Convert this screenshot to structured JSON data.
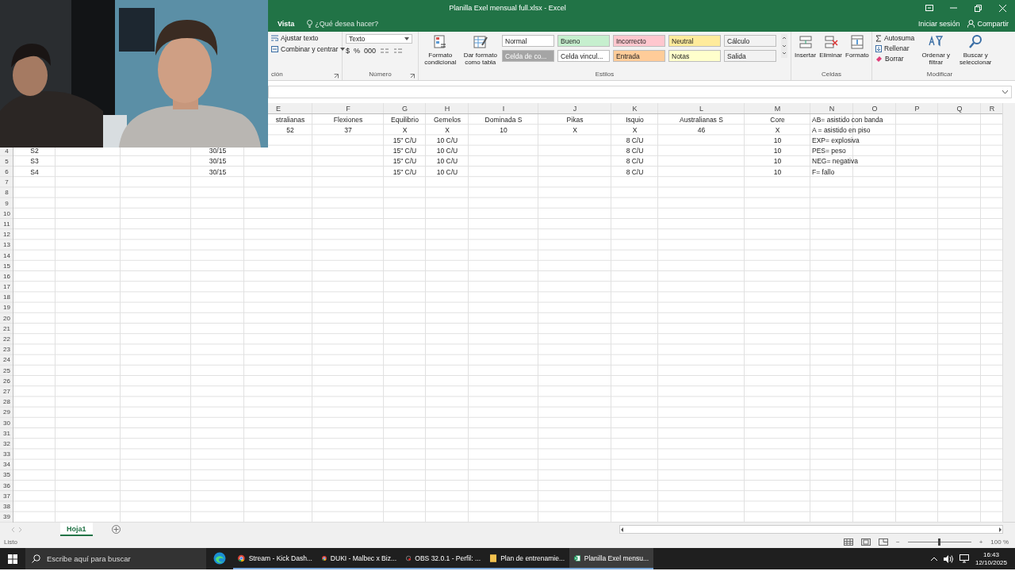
{
  "window": {
    "title": "Planilla Exel mensual full.xlsx - Excel"
  },
  "ribbon_tabs": {
    "tabs": [
      {
        "label": "Vista",
        "selected": false
      }
    ],
    "search": "¿Qué desea hacer?",
    "sign_in": "Iniciar sesión",
    "share": "Compartir"
  },
  "ribbon": {
    "alignment": {
      "buttons": [
        "Ajustar texto",
        "Combinar y centrar"
      ],
      "label": "ción"
    },
    "number": {
      "format": "Texto",
      "buttons": [
        "$",
        "%",
        "000"
      ],
      "label": "Número"
    },
    "styles": {
      "buttons": [
        "Formato condicional",
        "Dar formato como tabla"
      ],
      "label": "Estilos",
      "gallery": [
        {
          "label": "Normal",
          "color": "#ffffff"
        },
        {
          "label": "Bueno",
          "color": "#c6efce"
        },
        {
          "label": "Incorrecto",
          "color": "#ffc7ce"
        },
        {
          "label": "Neutral",
          "color": "#ffeb9c"
        },
        {
          "label": "Cálculo",
          "color": "#f2f2f2"
        },
        {
          "label": "Celda de co...",
          "color": "#a5a5a5"
        },
        {
          "label": "Celda vincul...",
          "color": "#ffffff"
        },
        {
          "label": "Entrada",
          "color": "#ffcc99"
        },
        {
          "label": "Notas",
          "color": "#ffffcc"
        },
        {
          "label": "Salida",
          "color": "#f2f2f2"
        }
      ]
    },
    "cells": {
      "buttons": [
        "Insertar",
        "Eliminar",
        "Formato"
      ],
      "label": "Celdas"
    },
    "editing": {
      "small_buttons": [
        "Autosuma",
        "Rellenar",
        "Borrar"
      ],
      "buttons": [
        "Ordenar y filtrar",
        "Buscar y seleccionar"
      ],
      "label": "Modificar"
    }
  },
  "sheet": {
    "columns": [
      "E",
      "F",
      "G",
      "H",
      "I",
      "J",
      "K",
      "L",
      "M",
      "N",
      "O",
      "P",
      "Q",
      "R"
    ],
    "rows": [
      {
        "cells": [
          null,
          null,
          null,
          null,
          "stralianas",
          "Flexiones",
          "Equilibrio",
          "Gemelos",
          "Dominada S",
          "Pikas",
          "Isquio",
          "Australianas S",
          "Core",
          "AB= asistido con banda"
        ]
      },
      {
        "cells": [
          null,
          null,
          null,
          null,
          "52",
          "37",
          "X",
          "X",
          "10",
          "X",
          "X",
          "46",
          "X",
          "A = asistido en piso"
        ]
      },
      {
        "cells": [
          null,
          null,
          null,
          null,
          null,
          null,
          "15\" C/U",
          "10 C/U",
          null,
          null,
          "8 C/U",
          null,
          "10",
          "EXP= explosiva"
        ]
      },
      {
        "number": "4",
        "cells": [
          "S2",
          null,
          null,
          "30/15",
          null,
          null,
          "15\" C/U",
          "10 C/U",
          null,
          null,
          "8 C/U",
          null,
          "10",
          "PES= peso"
        ]
      },
      {
        "number": "5",
        "cells": [
          "S3",
          null,
          null,
          "30/15",
          null,
          null,
          "15\" C/U",
          "10 C/U",
          null,
          null,
          "8 C/U",
          null,
          "10",
          "NEG= negativa"
        ]
      },
      {
        "number": "6",
        "cells": [
          "S4",
          null,
          null,
          "30/15",
          null,
          null,
          "15\" C/U",
          "10 C/U",
          null,
          null,
          "8 C/U",
          null,
          "10",
          "F= fallo"
        ]
      },
      {
        "number": "7"
      },
      {
        "number": "8"
      },
      {
        "number": "9"
      },
      {
        "number": "10"
      },
      {
        "number": "11"
      },
      {
        "number": "12"
      },
      {
        "number": "13"
      },
      {
        "number": "14"
      },
      {
        "number": "15"
      },
      {
        "number": "16"
      },
      {
        "number": "17"
      },
      {
        "number": "18"
      },
      {
        "number": "19"
      },
      {
        "number": "20"
      },
      {
        "number": "21"
      },
      {
        "number": "22"
      },
      {
        "number": "23"
      },
      {
        "number": "24"
      },
      {
        "number": "25"
      },
      {
        "number": "26"
      },
      {
        "number": "27"
      },
      {
        "number": "28"
      },
      {
        "number": "29"
      },
      {
        "number": "30"
      },
      {
        "number": "31"
      },
      {
        "number": "32"
      },
      {
        "number": "33"
      },
      {
        "number": "34"
      },
      {
        "number": "35"
      },
      {
        "number": "36"
      },
      {
        "number": "37"
      },
      {
        "number": "38"
      },
      {
        "number": "39"
      }
    ],
    "tabs": [
      {
        "label": "Hoja1",
        "selected": true
      }
    ]
  },
  "status_bar": {
    "text": "Listo",
    "zoom_out": "−",
    "zoom_in": "+",
    "zoom": "100 %",
    "level": 0.5
  },
  "taskbar": {
    "search": "Escribe aquí para buscar",
    "items": [
      {
        "kind": "chrome",
        "label": "Stream - Kick Dash...",
        "selected": false
      },
      {
        "kind": "chrome",
        "label": "DUKI - Malbec x Biz...",
        "selected": false
      },
      {
        "kind": "obs",
        "label": "OBS 32.0.1 - Perfil: ...",
        "selected": false
      },
      {
        "kind": "folder",
        "label": "Plan de entrenamie...",
        "selected": false
      },
      {
        "kind": "excel",
        "label": "Planilla Exel mensu...",
        "selected": true
      }
    ],
    "time": "16:43",
    "date": "12/10/2025"
  }
}
